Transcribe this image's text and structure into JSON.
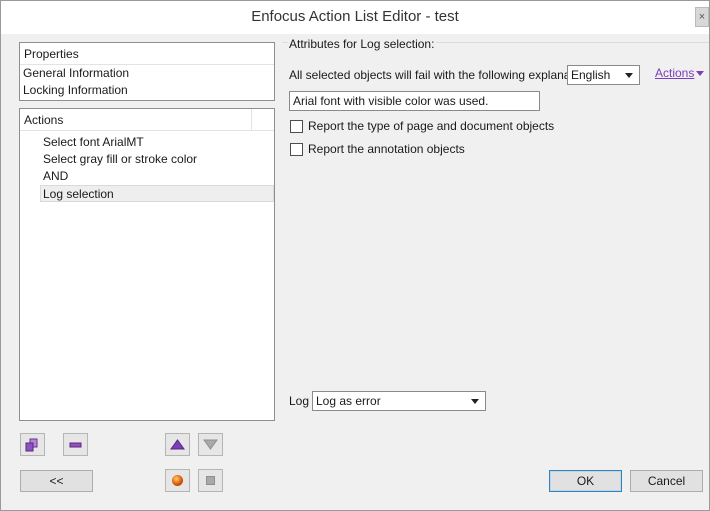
{
  "window": {
    "title": "Enfocus Action List Editor - test",
    "close_glyph": "×"
  },
  "properties": {
    "header": "Properties",
    "items": [
      "General Information",
      "Locking Information"
    ]
  },
  "actions": {
    "header": "Actions",
    "items": [
      "Select font ArialMT",
      "Select gray fill or stroke color",
      "AND",
      "Log selection"
    ],
    "selected_index": 3
  },
  "attributes": {
    "group_label": "Attributes for Log selection:",
    "explanation_label": "All selected objects will fail with the following explanation",
    "language_value": "English",
    "actions_link": "Actions",
    "explanation_text": "Arial font with visible color was used.",
    "checkbox_page_label": "Report the type of page and document objects",
    "checkbox_page_checked": false,
    "checkbox_annot_label": "Report the annotation objects",
    "checkbox_annot_checked": false,
    "log_label": "Log",
    "log_value": "Log as error"
  },
  "toolbar": {
    "add_icon": "add-action-icon",
    "remove_icon": "remove-action-icon",
    "move_up_icon": "move-up-icon",
    "move_down_icon": "move-down-icon",
    "record_icon": "record-icon",
    "stop_icon": "stop-icon"
  },
  "buttons": {
    "collapse": "<<",
    "ok": "OK",
    "cancel": "Cancel"
  },
  "colors": {
    "accent_purple": "#7b3fb8",
    "record_orange": "#e8731a",
    "default_button_border": "#3c7fb1"
  }
}
